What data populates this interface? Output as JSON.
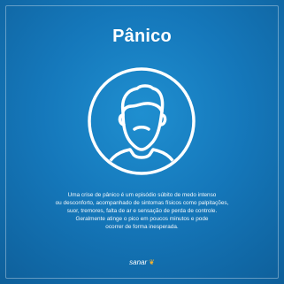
{
  "title": "Pânico",
  "icon": "man-bearded-avatar-icon",
  "colors": {
    "background": "#1578bb",
    "foreground": "#ffffff",
    "accent": "#f2b230"
  },
  "description_lines": [
    "Uma crise de pânico é um episódio súbito de medo intenso",
    "ou desconforto, acompanhado de sintomas físicos como palpitações,",
    "suor, tremores, falta de ar e sensação de perda de controle.",
    "Geralmente atinge o pico em poucos minutos e pode",
    "ocorrer de forma inesperada."
  ],
  "logo": {
    "text": "sanar",
    "mark": "leaf-icon"
  }
}
